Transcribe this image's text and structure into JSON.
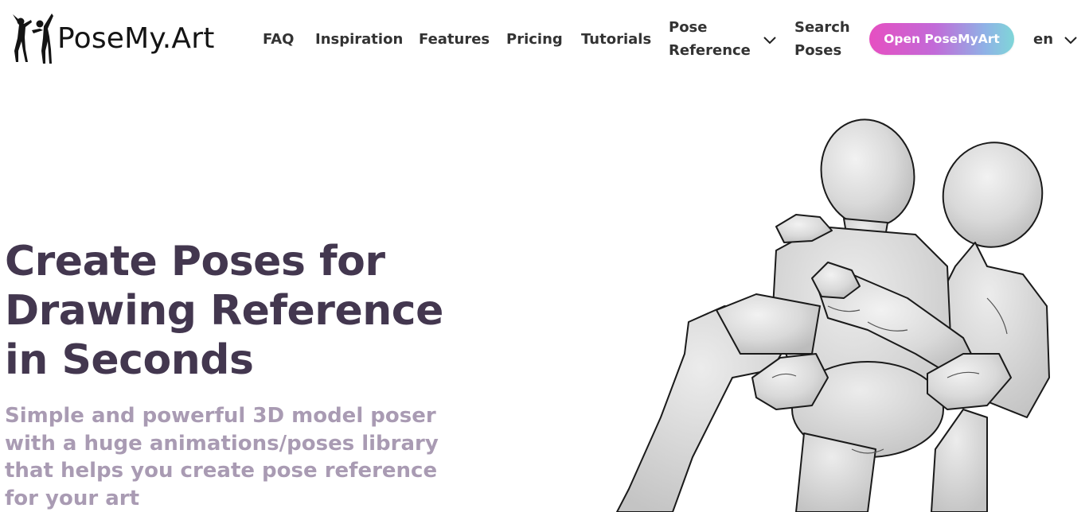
{
  "brand": {
    "name": "PoseMy.Art"
  },
  "nav": {
    "faq": "FAQ",
    "inspiration": "Inspiration",
    "features": "Features",
    "pricing": "Pricing",
    "tutorials": "Tutorials",
    "pose_reference_line1": "Pose",
    "pose_reference_line2": "Reference",
    "search_poses_line1": "Search",
    "search_poses_line2": "Poses",
    "cta": "Open PoseMyArt",
    "language": "en"
  },
  "hero": {
    "title_lines": [
      "Create Poses for",
      "Drawing Reference",
      "in Seconds"
    ],
    "subtitle_lines": [
      "Simple and powerful 3D model poser",
      "with a huge animations/poses library",
      "that helps you create pose reference",
      "for your art"
    ]
  },
  "icons": {
    "logo": "dancers-silhouette-logo",
    "pose_reference_dropdown": "chevron-down-icon",
    "language_dropdown": "chevron-down-icon",
    "hero_image": "3d-mannequins-carrying-pose"
  },
  "colors": {
    "title": "#43374f",
    "subtitle": "#a99bb3",
    "nav_text": "#333333",
    "cta_gradient_start": "#e64fc1",
    "cta_gradient_end": "#7fd6d8"
  }
}
